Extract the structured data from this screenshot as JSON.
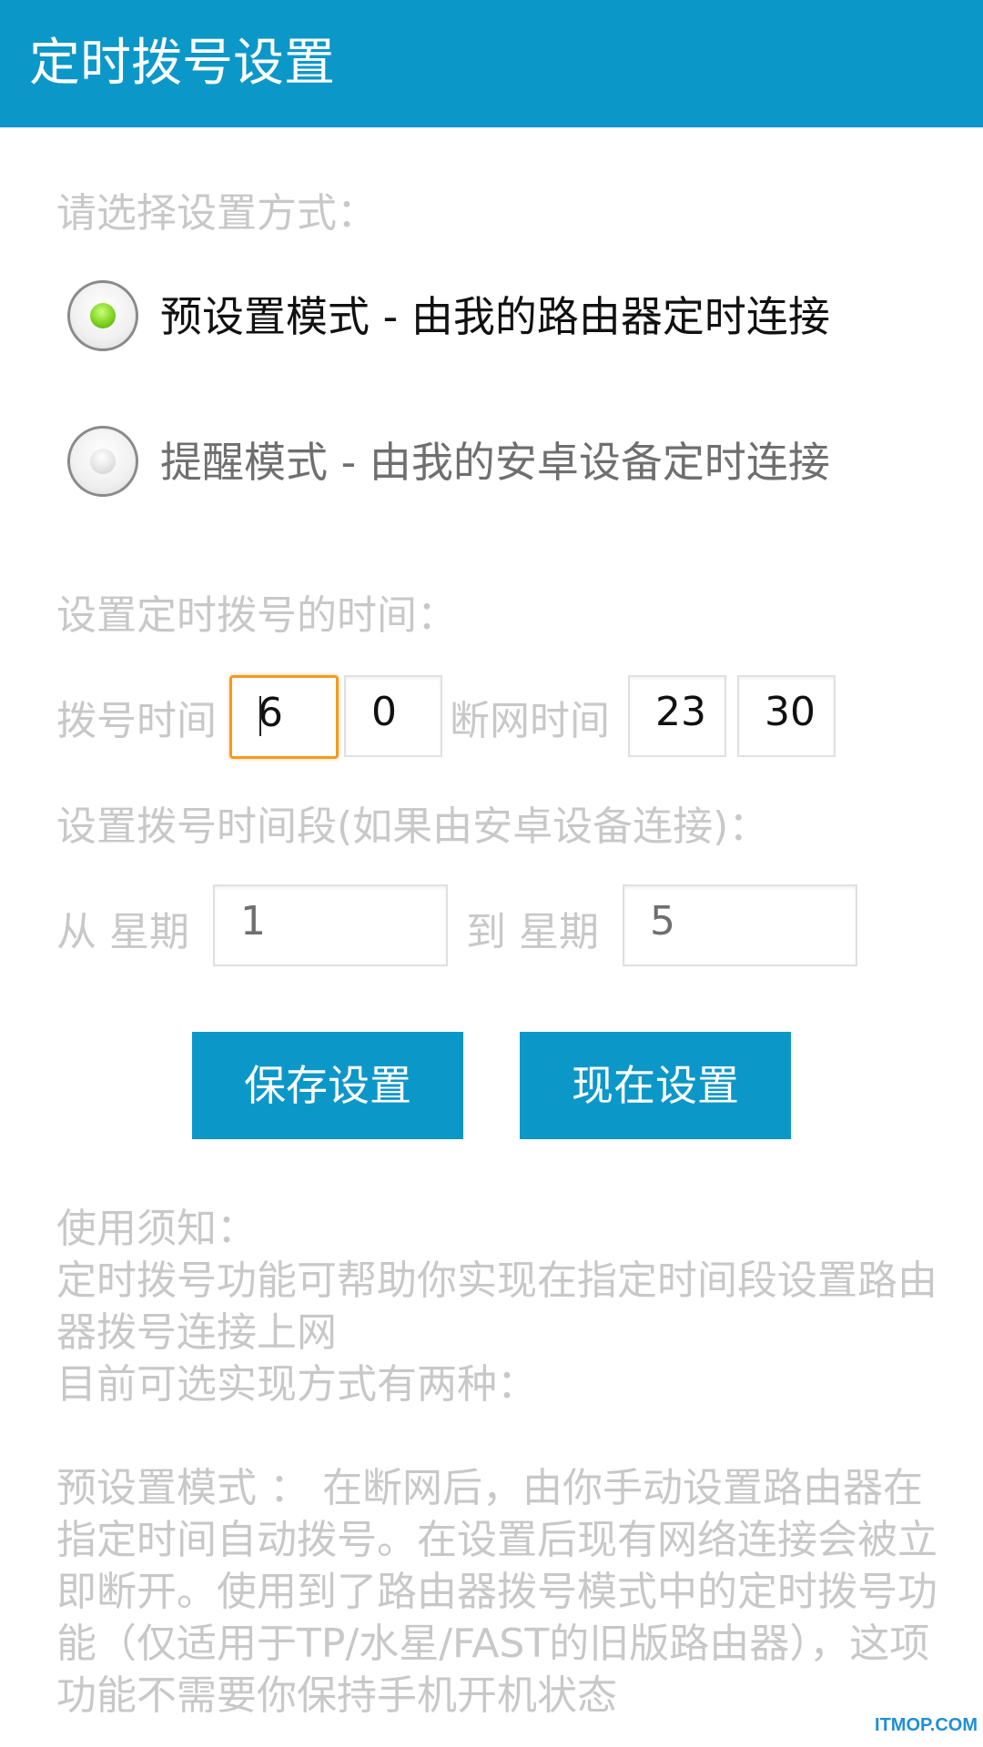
{
  "appbar": {
    "title": "定时拨号设置"
  },
  "mode_section": {
    "prompt": "请选择设置方式：",
    "options": [
      {
        "label": "预设置模式 - 由我的路由器定时连接",
        "selected": true
      },
      {
        "label": "提醒模式 - 由我的安卓设备定时连接",
        "selected": false
      }
    ]
  },
  "time_section": {
    "prompt": "设置定时拨号的时间：",
    "dial_label": "拨号时间",
    "dial_hour": "6",
    "dial_minute": "0",
    "disconnect_label": "断网时间",
    "disconnect_hour": "23",
    "disconnect_minute": "30"
  },
  "period_section": {
    "prompt": "设置拨号时间段(如果由安卓设备连接)：",
    "from_label": "从 星期",
    "from_day": "1",
    "to_label": "到 星期",
    "to_day": "5"
  },
  "buttons": {
    "save": "保存设置",
    "now": "现在设置"
  },
  "notes": {
    "title": "使用须知：",
    "line1": "定时拨号功能可帮助你实现在指定时间段设置路由器拨号连接上网",
    "line2": "目前可选实现方式有两种：",
    "line3": "预设置模式 ： 在断网后，由你手动设置路由器在指定时间自动拨号。在设置后现有网络连接会被立即断开。使用到了路由器拨号模式中的定时拨号功能（仅适用于TP/水星/FAST的旧版路由器），这项功能不需要你保持手机开机状态"
  },
  "watermark": "ITMOP.COM"
}
